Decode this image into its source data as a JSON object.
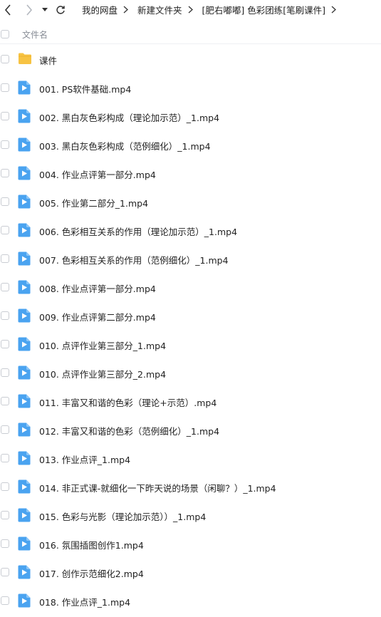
{
  "nav": {
    "back_icon": "chevron-left-icon",
    "forward_icon": "chevron-right-icon",
    "history_icon": "caret-down-icon",
    "refresh_icon": "refresh-icon"
  },
  "breadcrumb": [
    "我的网盘",
    "新建文件夹",
    "[肥右嘟嘟] 色彩团练[笔刷课件]"
  ],
  "header": {
    "column_label": "文件名"
  },
  "colors": {
    "folder": "#F7C343",
    "video": "#4AA3F0",
    "checkbox_border": "#C9CCD2",
    "header_text": "#888D96"
  },
  "files": [
    {
      "type": "folder",
      "name": "课件"
    },
    {
      "type": "video",
      "name": "001. PS软件基础.mp4"
    },
    {
      "type": "video",
      "name": "002. 黑白灰色彩构成（理论加示范）_1.mp4"
    },
    {
      "type": "video",
      "name": "003. 黑白灰色彩构成（范例细化）_1.mp4"
    },
    {
      "type": "video",
      "name": "004. 作业点评第一部分.mp4"
    },
    {
      "type": "video",
      "name": "005. 作业第二部分_1.mp4"
    },
    {
      "type": "video",
      "name": "006. 色彩相互关系的作用（理论加示范）_1.mp4"
    },
    {
      "type": "video",
      "name": "007. 色彩相互关系的作用（范例细化）_1.mp4"
    },
    {
      "type": "video",
      "name": "008. 作业点评第一部分.mp4"
    },
    {
      "type": "video",
      "name": "009. 作业点评第二部分.mp4"
    },
    {
      "type": "video",
      "name": "010. 点评作业第三部分_1.mp4"
    },
    {
      "type": "video",
      "name": "010. 点评作业第三部分_2.mp4"
    },
    {
      "type": "video",
      "name": "011. 丰富又和谐的色彩（理论+示范）.mp4"
    },
    {
      "type": "video",
      "name": "012. 丰富又和谐的色彩（范例细化）_1.mp4"
    },
    {
      "type": "video",
      "name": "013. 作业点评_1.mp4"
    },
    {
      "type": "video",
      "name": "014. 非正式课-就细化一下昨天说的场景（闲聊？）_1.mp4"
    },
    {
      "type": "video",
      "name": "015. 色彩与光影（理论加示范））_1.mp4"
    },
    {
      "type": "video",
      "name": "016. 氛围插图创作1.mp4"
    },
    {
      "type": "video",
      "name": "017. 创作示范细化2.mp4"
    },
    {
      "type": "video",
      "name": "018. 作业点评_1.mp4"
    }
  ]
}
